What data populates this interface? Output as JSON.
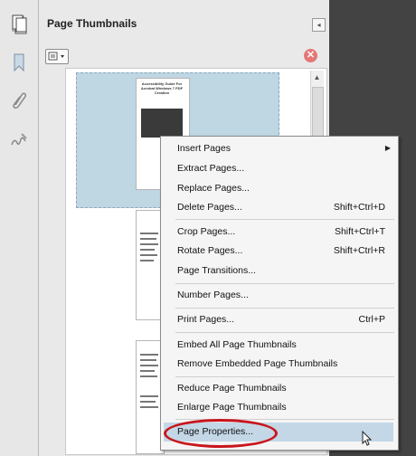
{
  "panel": {
    "title": "Page Thumbnails"
  },
  "thumbnails": {
    "page1_title": "Accessibility Guide For Acrobat Windows 7 PDF Creation"
  },
  "context_menu": {
    "groups": [
      [
        {
          "label": "Insert Pages",
          "shortcut": "",
          "submenu": true
        },
        {
          "label": "Extract Pages...",
          "shortcut": ""
        },
        {
          "label": "Replace Pages...",
          "shortcut": ""
        },
        {
          "label": "Delete Pages...",
          "shortcut": "Shift+Ctrl+D"
        }
      ],
      [
        {
          "label": "Crop Pages...",
          "shortcut": "Shift+Ctrl+T"
        },
        {
          "label": "Rotate Pages...",
          "shortcut": "Shift+Ctrl+R"
        },
        {
          "label": "Page Transitions...",
          "shortcut": ""
        }
      ],
      [
        {
          "label": "Number Pages...",
          "shortcut": ""
        }
      ],
      [
        {
          "label": "Print Pages...",
          "shortcut": "Ctrl+P"
        }
      ],
      [
        {
          "label": "Embed All Page Thumbnails",
          "shortcut": ""
        },
        {
          "label": "Remove Embedded Page Thumbnails",
          "shortcut": ""
        }
      ],
      [
        {
          "label": "Reduce Page Thumbnails",
          "shortcut": ""
        },
        {
          "label": "Enlarge Page Thumbnails",
          "shortcut": ""
        }
      ],
      [
        {
          "label": "Page Properties...",
          "shortcut": "",
          "highlighted": true
        }
      ]
    ]
  },
  "icons": {
    "left_rail": [
      "pages-icon",
      "bookmark-icon",
      "paperclip-icon",
      "signature-icon"
    ],
    "toolbar": [
      "thumbnail-options-icon",
      "close-panel-icon"
    ]
  },
  "colors": {
    "selection_fill": "#bfd6e3",
    "menu_highlight": "#c3d7e6",
    "annotation_ring": "#c8151c",
    "sidebar_dark": "#434343"
  }
}
